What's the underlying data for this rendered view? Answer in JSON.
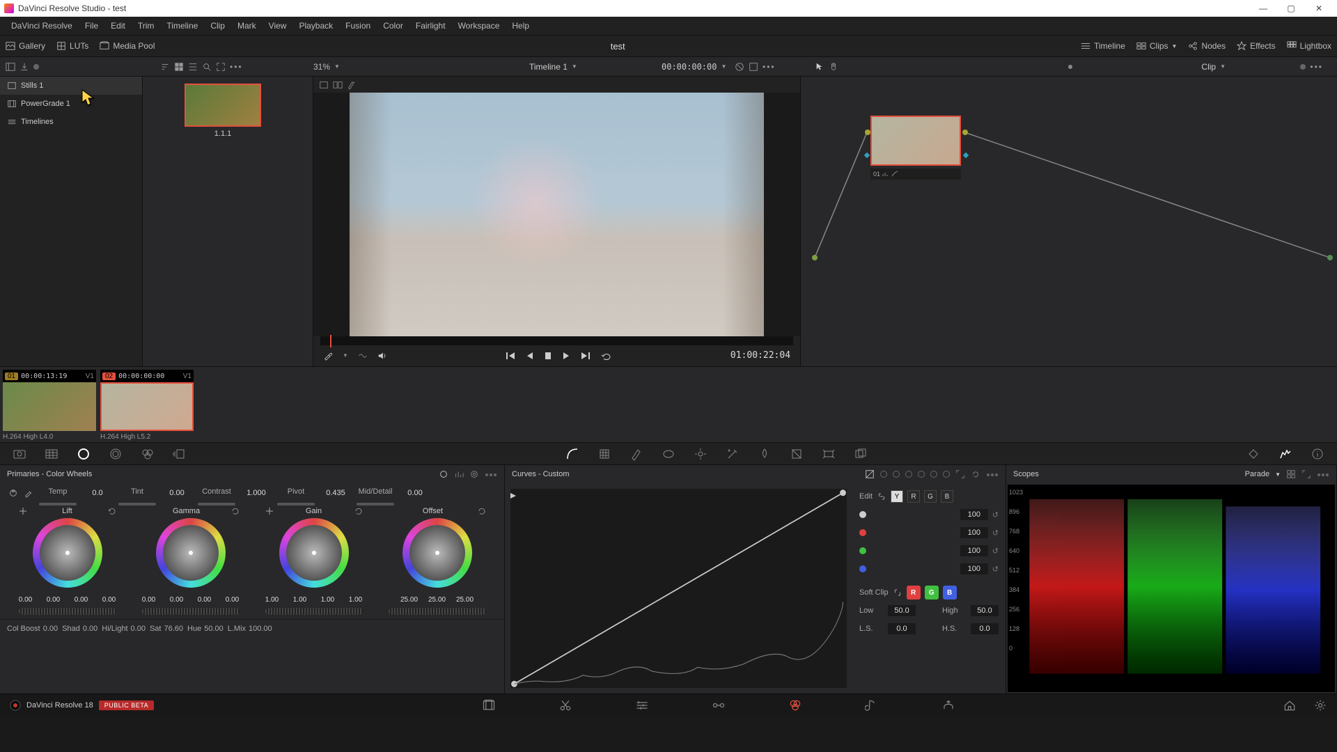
{
  "window": {
    "title": "DaVinci Resolve Studio - test"
  },
  "menubar": [
    "DaVinci Resolve",
    "File",
    "Edit",
    "Trim",
    "Timeline",
    "Clip",
    "Mark",
    "View",
    "Playback",
    "Fusion",
    "Color",
    "Fairlight",
    "Workspace",
    "Help"
  ],
  "toolbar": {
    "gallery": "Gallery",
    "luts": "LUTs",
    "mediapool": "Media Pool",
    "project": "test",
    "timeline_btn": "Timeline",
    "clips_btn": "Clips",
    "nodes_btn": "Nodes",
    "effects_btn": "Effects",
    "lightbox_btn": "Lightbox"
  },
  "subbar": {
    "zoom": "31%",
    "timeline_name": "Timeline 1",
    "timecode": "00:00:00:00",
    "clip_label": "Clip"
  },
  "gallery": {
    "albums": [
      "Stills 1",
      "PowerGrade 1",
      "Timelines"
    ],
    "still_label": "1.1.1"
  },
  "viewer": {
    "timecode": "01:00:22:04"
  },
  "node": {
    "label": "01"
  },
  "clips": [
    {
      "num": "01",
      "tc": "00:00:13:19",
      "track": "V1",
      "codec": "H.264 High L4.0",
      "active": false
    },
    {
      "num": "02",
      "tc": "00:00:00:00",
      "track": "V1",
      "codec": "H.264 High L5.2",
      "active": true
    }
  ],
  "primaries": {
    "title": "Primaries - Color Wheels",
    "temp_l": "Temp",
    "temp_v": "0.0",
    "tint_l": "Tint",
    "tint_v": "0.00",
    "contrast_l": "Contrast",
    "contrast_v": "1.000",
    "pivot_l": "Pivot",
    "pivot_v": "0.435",
    "md_l": "Mid/Detail",
    "md_v": "0.00",
    "wheels": [
      {
        "name": "Lift",
        "vals": [
          "0.00",
          "0.00",
          "0.00",
          "0.00"
        ]
      },
      {
        "name": "Gamma",
        "vals": [
          "0.00",
          "0.00",
          "0.00",
          "0.00"
        ]
      },
      {
        "name": "Gain",
        "vals": [
          "1.00",
          "1.00",
          "1.00",
          "1.00"
        ]
      },
      {
        "name": "Offset",
        "vals": [
          "25.00",
          "25.00",
          "25.00"
        ]
      }
    ],
    "row2": {
      "colboost_l": "Col Boost",
      "colboost_v": "0.00",
      "shad_l": "Shad",
      "shad_v": "0.00",
      "hl_l": "Hi/Light",
      "hl_v": "0.00",
      "sat_l": "Sat",
      "sat_v": "76.60",
      "hue_l": "Hue",
      "hue_v": "50.00",
      "lmix_l": "L.Mix",
      "lmix_v": "100.00"
    }
  },
  "curves": {
    "title": "Curves - Custom",
    "edit_l": "Edit",
    "channels": {
      "Y": "Y",
      "R": "R",
      "G": "G",
      "B": "B"
    },
    "vals": [
      "100",
      "100",
      "100",
      "100"
    ],
    "softclip_l": "Soft Clip",
    "low_l": "Low",
    "low_v": "50.0",
    "high_l": "High",
    "high_v": "50.0",
    "ls_l": "L.S.",
    "ls_v": "0.0",
    "hs_l": "H.S.",
    "hs_v": "0.0"
  },
  "scopes": {
    "title": "Scopes",
    "mode": "Parade",
    "ticks": [
      "1023",
      "896",
      "768",
      "640",
      "512",
      "384",
      "256",
      "128",
      "0"
    ]
  },
  "pagebar": {
    "version": "DaVinci Resolve 18",
    "badge": "PUBLIC BETA"
  }
}
